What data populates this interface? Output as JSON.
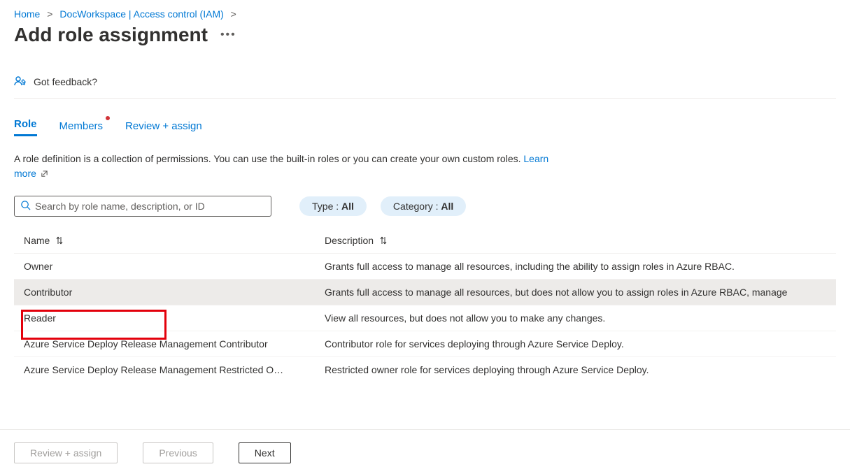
{
  "breadcrumb": {
    "home": "Home",
    "workspace": "DocWorkspace | Access control (IAM)"
  },
  "page_title": "Add role assignment",
  "feedback_label": "Got feedback?",
  "tabs": {
    "role": "Role",
    "members": "Members",
    "review": "Review + assign"
  },
  "role_intro": "A role definition is a collection of permissions. You can use the built-in roles or you can create your own custom roles. ",
  "learn_more": "Learn more",
  "search_placeholder": "Search by role name, description, or ID",
  "filters": {
    "type_label": "Type : ",
    "type_value": "All",
    "category_label": "Category : ",
    "category_value": "All"
  },
  "table_headers": {
    "name": "Name",
    "description": "Description"
  },
  "roles": [
    {
      "name": "Owner",
      "description": "Grants full access to manage all resources, including the ability to assign roles in Azure RBAC."
    },
    {
      "name": "Contributor",
      "description": "Grants full access to manage all resources, but does not allow you to assign roles in Azure RBAC, manage"
    },
    {
      "name": "Reader",
      "description": "View all resources, but does not allow you to make any changes."
    },
    {
      "name": "Azure Service Deploy Release Management Contributor",
      "description": "Contributor role for services deploying through Azure Service Deploy."
    },
    {
      "name": "Azure Service Deploy Release Management Restricted O…",
      "description": "Restricted owner role for services deploying through Azure Service Deploy."
    }
  ],
  "footer": {
    "review": "Review + assign",
    "previous": "Previous",
    "next": "Next"
  }
}
